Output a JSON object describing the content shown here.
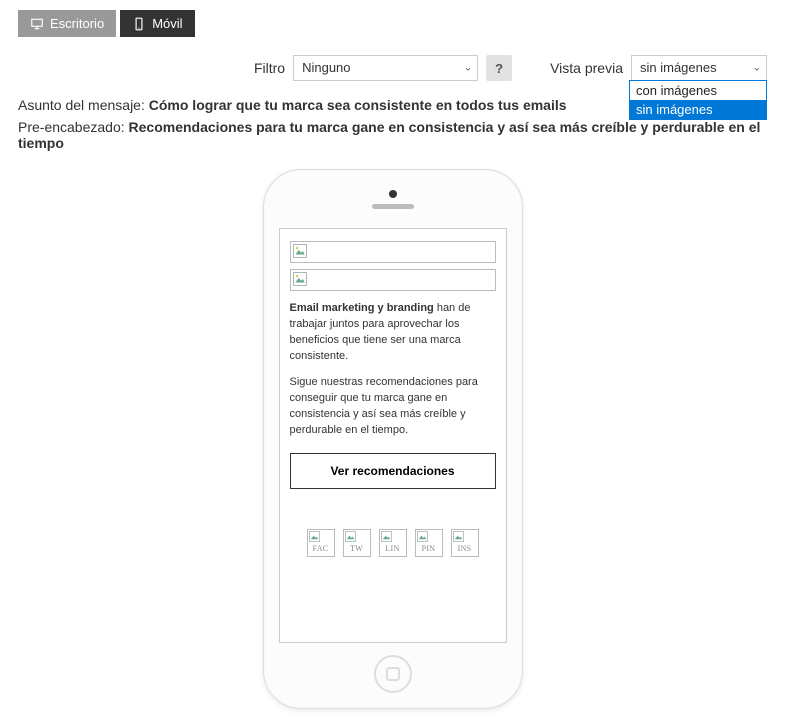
{
  "deviceTabs": {
    "desktop": "Escritorio",
    "mobile": "Móvil"
  },
  "filter": {
    "label": "Filtro",
    "selected": "Ninguno"
  },
  "preview": {
    "label": "Vista previa",
    "selected": "sin imágenes",
    "options": [
      "con imágenes",
      "sin imágenes"
    ]
  },
  "meta": {
    "subjectLabel": "Asunto del mensaje:",
    "subjectValue": "Cómo lograr que tu marca sea consistente en todos tus emails",
    "preheaderLabel": "Pre-encabezado:",
    "preheaderValue": "Recomendaciones para tu marca gane en consistencia y así sea más creíble y perdurable en el tiempo"
  },
  "emailContent": {
    "strong1": "Email marketing y branding",
    "p1rest": " han de trabajar juntos para aprovechar los beneficios que tiene ser una marca consistente.",
    "p2": "Sigue nuestras recomendaciones para conseguir que tu marca gane en consistencia y así sea más creíble y perdurable en el tiempo.",
    "cta": "Ver recomendaciones",
    "social": [
      "FAC",
      "TW",
      "LIN",
      "PIN",
      "INS"
    ]
  }
}
